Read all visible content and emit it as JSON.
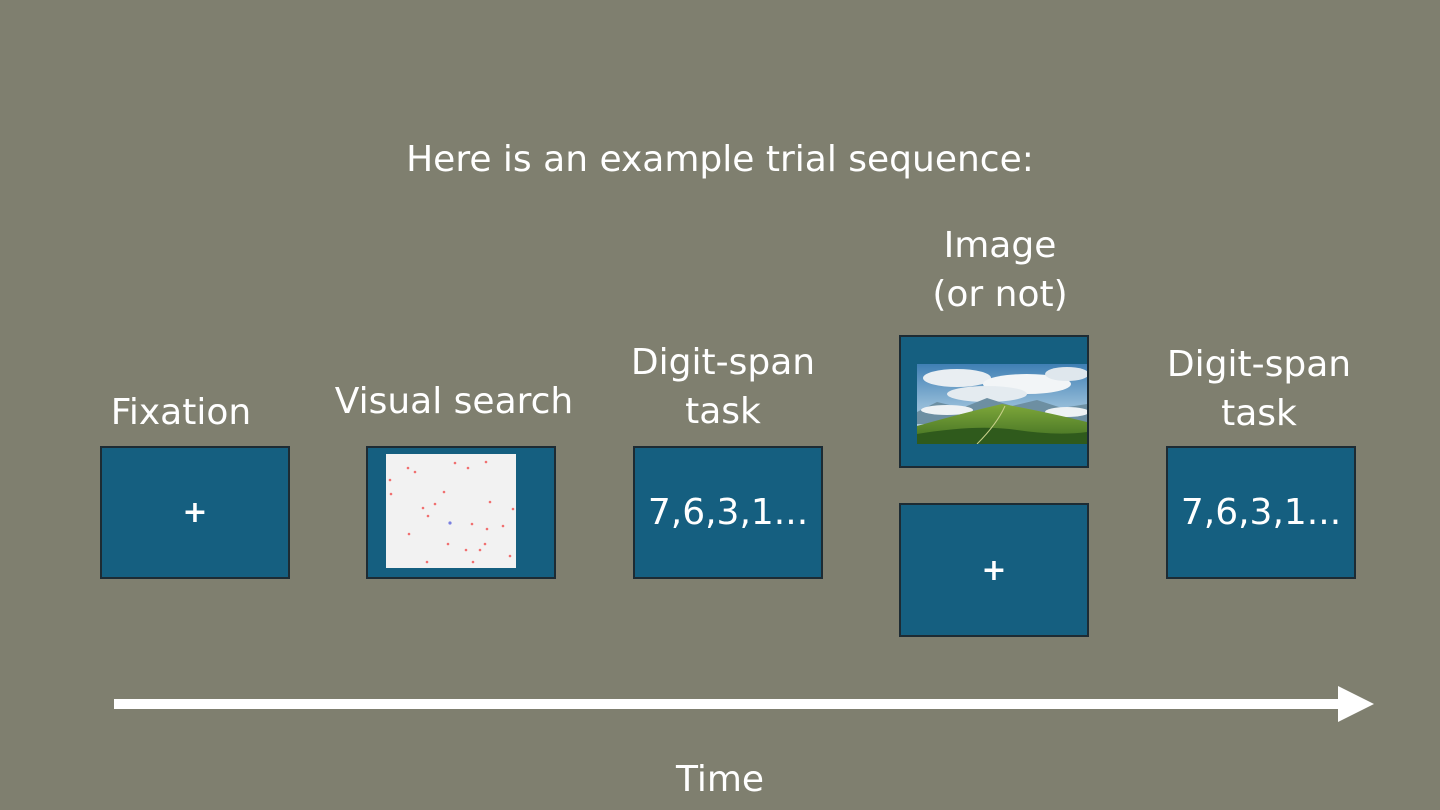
{
  "slide": {
    "title": "Here is an example trial sequence:",
    "time_label": "Time"
  },
  "steps": {
    "fixation": {
      "label": "Fixation",
      "screen_text": "+"
    },
    "visual_search": {
      "label": "Visual search"
    },
    "digit_span_1": {
      "label_line1": "Digit-span",
      "label_line2": "task",
      "screen_text": "7,6,3,1..."
    },
    "image": {
      "label_line1": "Image",
      "label_line2": "(or not)",
      "alt_screen_text": "+"
    },
    "digit_span_2": {
      "label_line1": "Digit-span",
      "label_line2": "task",
      "screen_text": "7,6,3,1..."
    }
  },
  "colors": {
    "background": "#7f7f6f",
    "screen_fill": "#155f80",
    "screen_border": "#1d2b33",
    "search_target": "#7a80e0",
    "search_distractor": "#f07070"
  }
}
